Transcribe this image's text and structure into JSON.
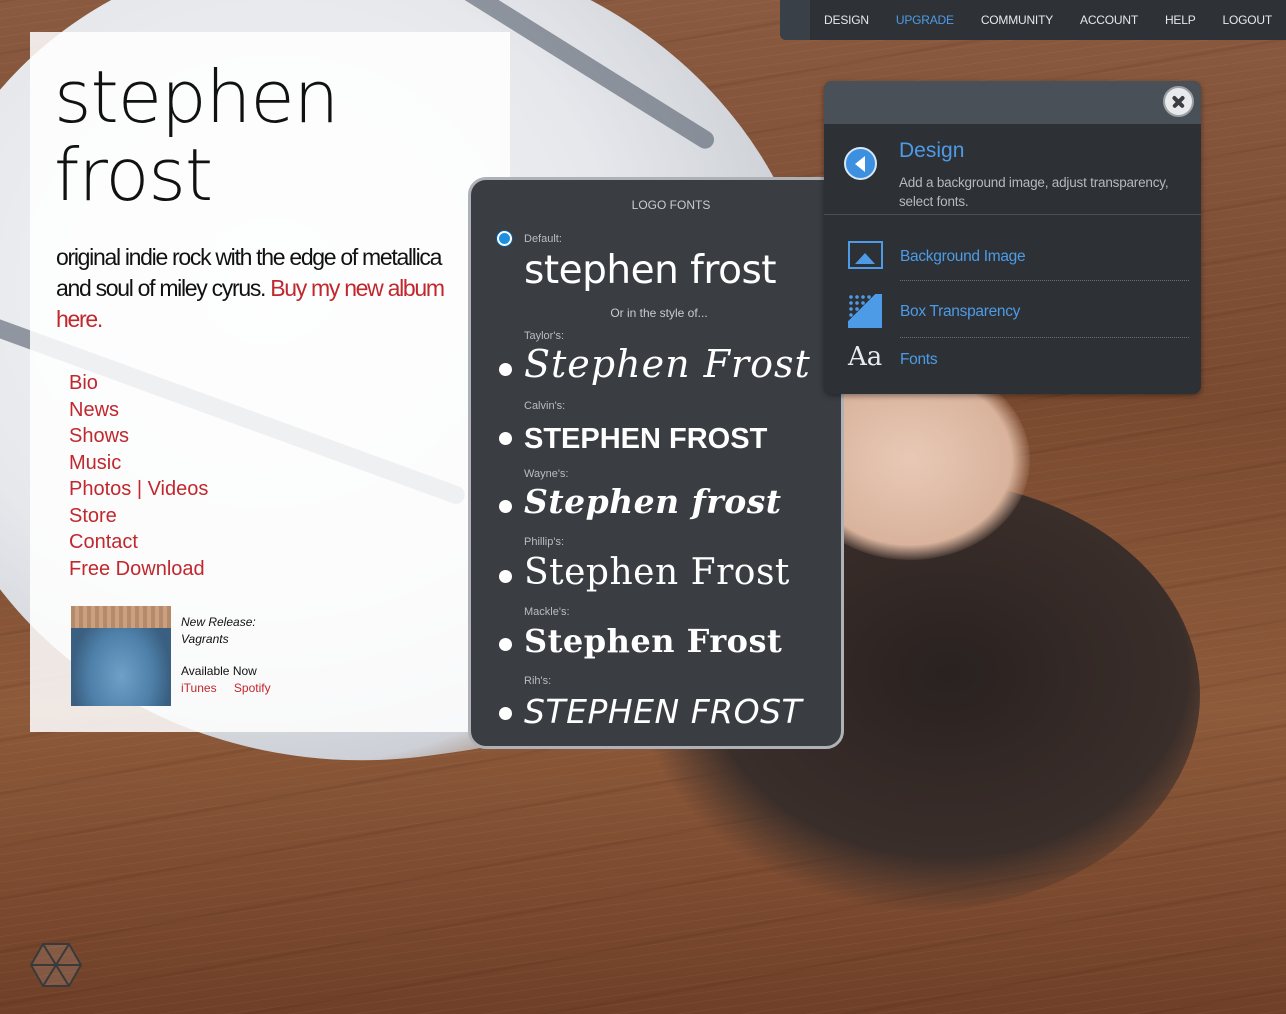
{
  "topnav": {
    "items": [
      {
        "label": "DESIGN"
      },
      {
        "label": "UPGRADE",
        "active": true
      },
      {
        "label": "COMMUNITY"
      },
      {
        "label": "ACCOUNT"
      },
      {
        "label": "HELP"
      },
      {
        "label": "LOGOUT"
      }
    ]
  },
  "site": {
    "logo_line1": "stephen",
    "logo_line2": "frost",
    "tagline": "original indie rock with the edge of metallica and soul of miley cyrus.",
    "tagline_link": "Buy my new album here.",
    "nav": [
      "Bio",
      "News",
      "Shows",
      "Music",
      "Photos | Videos",
      "Store",
      "Contact",
      "Free Download"
    ],
    "release": {
      "title_line1": "New Release:",
      "title_line2": "Vagrants",
      "available": "Available Now",
      "links": [
        "iTunes",
        "Spotify"
      ]
    }
  },
  "logo_fonts": {
    "title": "LOGO FONTS",
    "default_label": "Default:",
    "default_sample": "stephen frost",
    "or_style": "Or in the style of...",
    "options": [
      {
        "label": "Taylor's:",
        "sample": "Stephen Frost"
      },
      {
        "label": "Calvin's:",
        "sample": "STEPHEN FROST"
      },
      {
        "label": "Wayne's:",
        "sample": "Stephen frost"
      },
      {
        "label": "Phillip's:",
        "sample": "Stephen Frost"
      },
      {
        "label": "Mackle's:",
        "sample": "Stephen Frost"
      },
      {
        "label": "Rih's:",
        "sample": "STEPHEN FROST"
      }
    ]
  },
  "design_panel": {
    "title": "Design",
    "description": "Add a background image, adjust transparency, select fonts.",
    "items": [
      {
        "label": "Background Image",
        "icon": "landscape-image-icon"
      },
      {
        "label": "Box Transparency",
        "icon": "transparency-grid-icon"
      },
      {
        "label": "Fonts",
        "icon": "font-aa-icon"
      }
    ]
  },
  "colors": {
    "accent_blue": "#4d9be6",
    "link_red": "#c0282e",
    "panel_dark": "#2d3135"
  }
}
